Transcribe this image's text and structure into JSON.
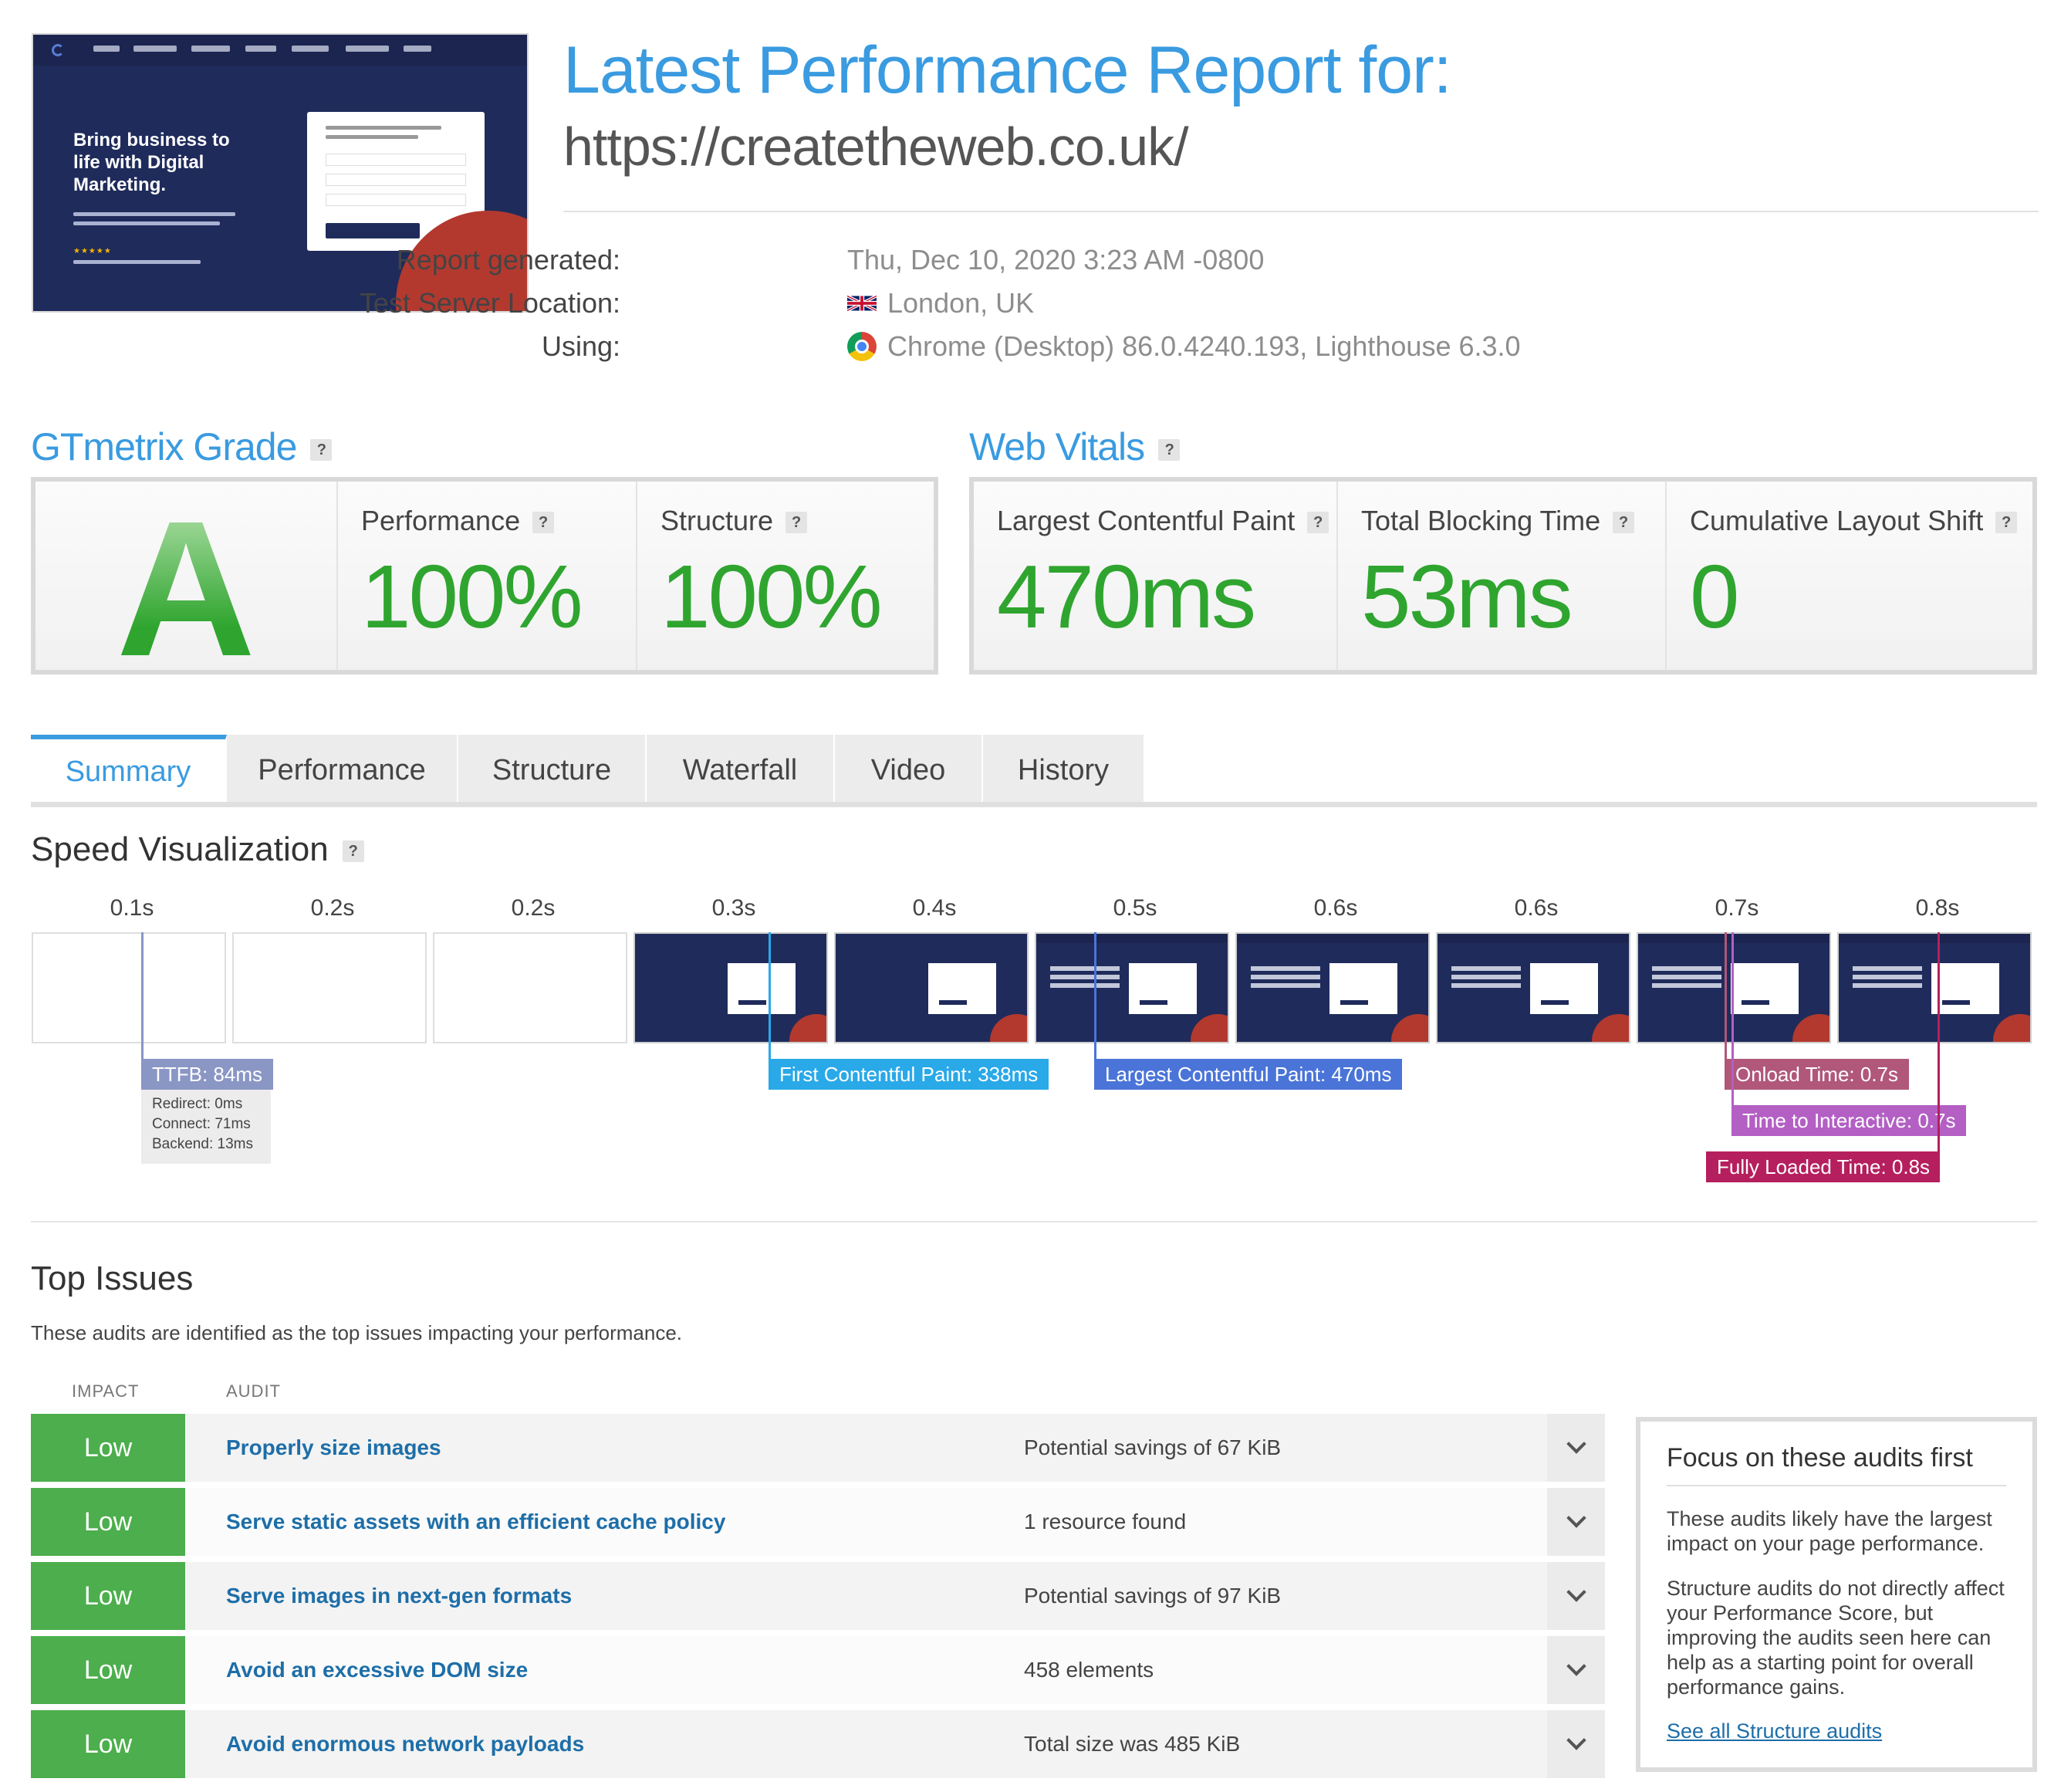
{
  "thumbnail": {
    "headline": "Bring business to life with Digital Marketing."
  },
  "header": {
    "title": "Latest Performance Report for:",
    "url": "https://createtheweb.co.uk/",
    "report_generated_label": "Report generated:",
    "report_generated_value": "Thu, Dec 10, 2020 3:23 AM -0800",
    "location_label": "Test Server Location:",
    "location_value": "London, UK",
    "using_label": "Using:",
    "using_value": "Chrome (Desktop) 86.0.4240.193, Lighthouse 6.3.0",
    "help_label": "?"
  },
  "grade": {
    "title": "GTmetrix Grade",
    "letter": "A",
    "performance_label": "Performance",
    "performance_value": "100%",
    "structure_label": "Structure",
    "structure_value": "100%"
  },
  "vitals": {
    "title": "Web Vitals",
    "lcp_label": "Largest Contentful Paint",
    "lcp_value": "470ms",
    "tbt_label": "Total Blocking Time",
    "tbt_value": "53ms",
    "cls_label": "Cumulative Layout Shift",
    "cls_value": "0"
  },
  "tabs": [
    "Summary",
    "Performance",
    "Structure",
    "Waterfall",
    "Video",
    "History"
  ],
  "speed": {
    "title": "Speed Visualization",
    "frame_times": [
      "0.1s",
      "0.2s",
      "0.2s",
      "0.3s",
      "0.4s",
      "0.5s",
      "0.6s",
      "0.6s",
      "0.7s",
      "0.8s"
    ],
    "ttfb": "TTFB: 84ms",
    "redirect": "Redirect: 0ms",
    "connect": "Connect: 71ms",
    "backend": "Backend: 13ms",
    "fcp": "First Contentful Paint: 338ms",
    "lcp": "Largest Contentful Paint: 470ms",
    "onload": "Onload Time: 0.7s",
    "tti": "Time to Interactive: 0.7s",
    "fully_loaded": "Fully Loaded Time: 0.8s",
    "colors": {
      "ttfb": "#8a96c4",
      "fcp": "#29a9e8",
      "lcp": "#4a74d8",
      "onload": "#b0577a",
      "tti": "#b35fc4",
      "fully_loaded": "#b51f5e"
    }
  },
  "issues": {
    "title": "Top Issues",
    "description": "These audits are identified as the top issues impacting your performance.",
    "col_impact": "IMPACT",
    "col_audit": "AUDIT",
    "rows": [
      {
        "impact": "Low",
        "audit": "Properly size images",
        "detail": "Potential savings of 67 KiB"
      },
      {
        "impact": "Low",
        "audit": "Serve static assets with an efficient cache policy",
        "detail": "1 resource found"
      },
      {
        "impact": "Low",
        "audit": "Serve images in next-gen formats",
        "detail": "Potential savings of 97 KiB"
      },
      {
        "impact": "Low",
        "audit": "Avoid an excessive DOM size",
        "detail": "458 elements"
      },
      {
        "impact": "Low",
        "audit": "Avoid enormous network payloads",
        "detail": "Total size was 485 KiB"
      }
    ]
  },
  "focus": {
    "title": "Focus on these audits first",
    "p1": "These audits likely have the largest impact on your page performance.",
    "p2": "Structure audits do not directly affect your Performance Score, but improving the audits seen here can help as a starting point for overall performance gains.",
    "link": "See all Structure audits"
  }
}
